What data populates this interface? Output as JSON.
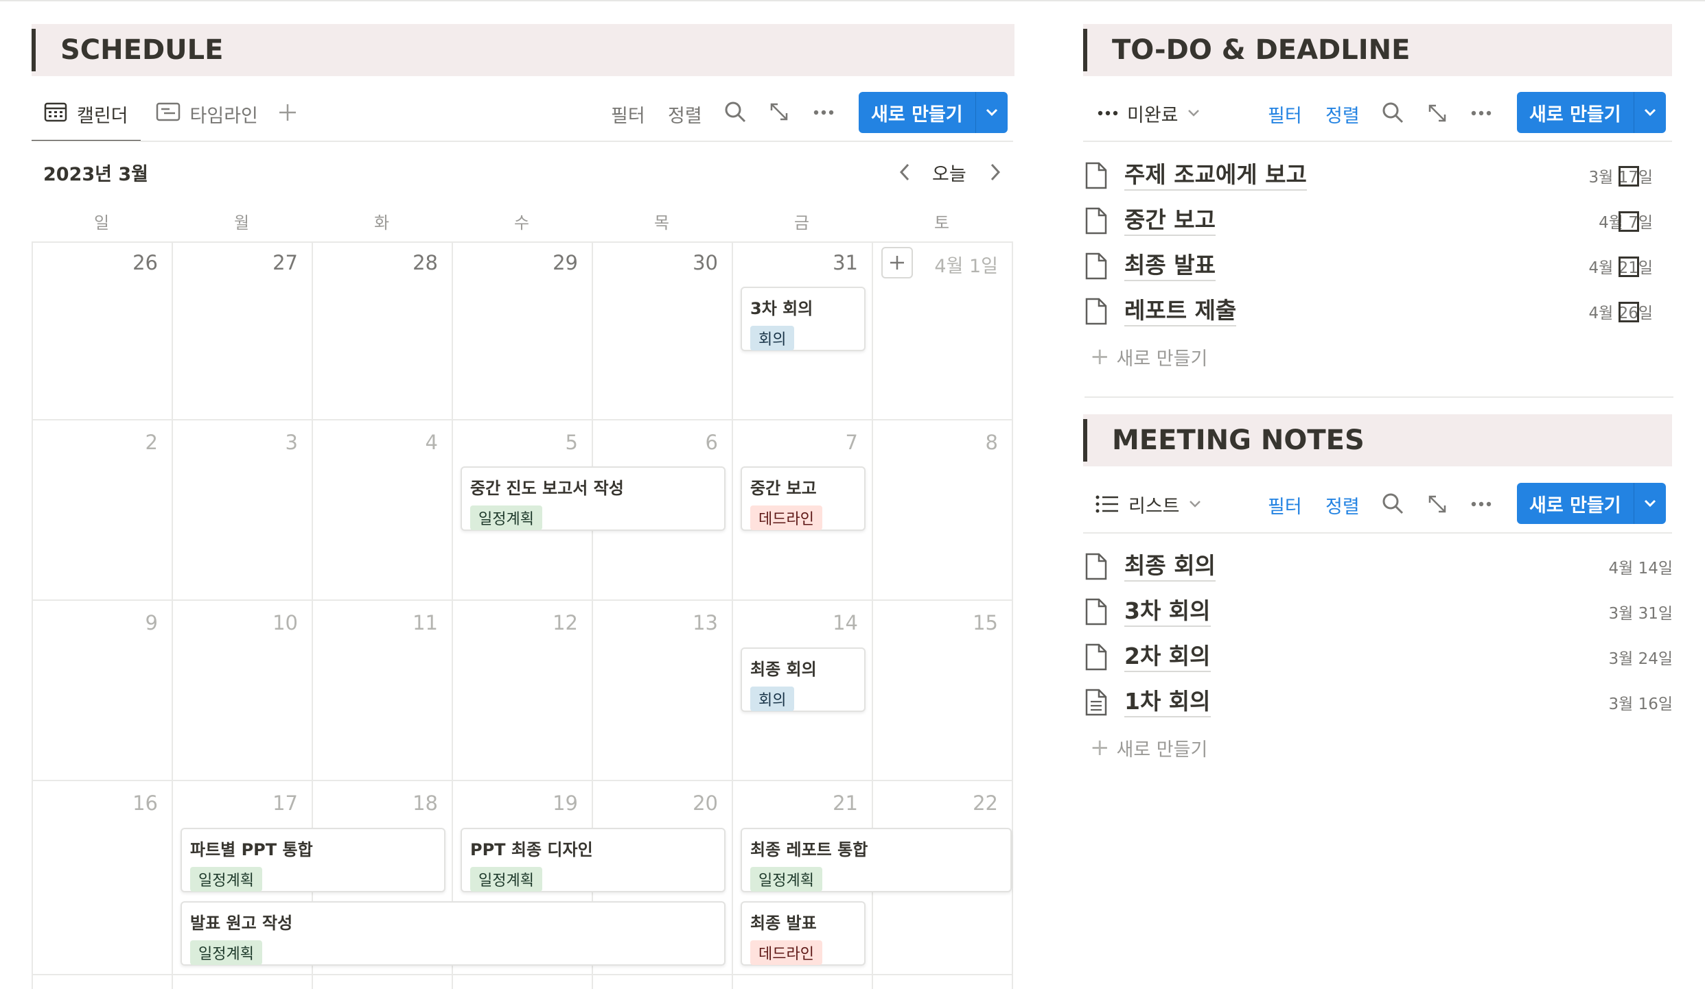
{
  "schedule": {
    "title": "SCHEDULE",
    "tabs": [
      {
        "label": "캘린더",
        "icon": "calendar-icon",
        "active": true
      },
      {
        "label": "타임라인",
        "icon": "timeline-icon",
        "active": false
      }
    ],
    "toolbar": {
      "filter": "필터",
      "sort": "정렬",
      "new": "새로 만들기"
    },
    "month_label": "2023년 3월",
    "today_label": "오늘",
    "weekdays": [
      "일",
      "월",
      "화",
      "수",
      "목",
      "금",
      "토"
    ],
    "weeks": [
      [
        "26",
        "27",
        "28",
        "29",
        "30",
        "31",
        "4월 1일"
      ],
      [
        "2",
        "3",
        "4",
        "5",
        "6",
        "7",
        "8"
      ],
      [
        "9",
        "10",
        "11",
        "12",
        "13",
        "14",
        "15"
      ],
      [
        "16",
        "17",
        "18",
        "19",
        "20",
        "21",
        "22"
      ]
    ],
    "events": [
      {
        "title": "3차 회의",
        "tag": "회의"
      },
      {
        "title": "중간 진도 보고서 작성",
        "tag": "일정계획"
      },
      {
        "title": "중간 보고",
        "tag": "데드라인"
      },
      {
        "title": "최종 회의",
        "tag": "회의"
      },
      {
        "title": "파트별 PPT 통합",
        "tag": "일정계획"
      },
      {
        "title": "PPT 최종 디자인",
        "tag": "일정계획"
      },
      {
        "title": "최종 레포트 통합",
        "tag": "일정계획"
      },
      {
        "title": "발표 원고 작성",
        "tag": "일정계획"
      },
      {
        "title": "최종 발표",
        "tag": "데드라인"
      }
    ]
  },
  "todo": {
    "title": "TO-DO & DEADLINE",
    "view_label": "미완료",
    "toolbar": {
      "filter": "필터",
      "sort": "정렬",
      "new": "새로 만들기"
    },
    "items": [
      {
        "name": "주제 조교에게 보고",
        "date": "3월 17일",
        "checked": false
      },
      {
        "name": "중간 보고",
        "date": "4월 7일",
        "checked": false
      },
      {
        "name": "최종 발표",
        "date": "4월 21일",
        "checked": false
      },
      {
        "name": "레포트 제출",
        "date": "4월 26일",
        "checked": false
      }
    ],
    "add_label": "새로 만들기"
  },
  "meeting": {
    "title": "MEETING NOTES",
    "view_label": "리스트",
    "toolbar": {
      "filter": "필터",
      "sort": "정렬",
      "new": "새로 만들기"
    },
    "items": [
      {
        "name": "최종 회의",
        "date": "4월 14일"
      },
      {
        "name": "3차 회의",
        "date": "3월 31일"
      },
      {
        "name": "2차 회의",
        "date": "3월 24일"
      },
      {
        "name": "1차 회의",
        "date": "3월 16일"
      }
    ],
    "add_label": "새로 만들기"
  },
  "colors": {
    "accent": "#2383e2",
    "header_bg": "#f3ecec",
    "tag_meeting": "#d3e5ef",
    "tag_plan": "#dbeddb",
    "tag_deadline": "#ffe2dd"
  }
}
